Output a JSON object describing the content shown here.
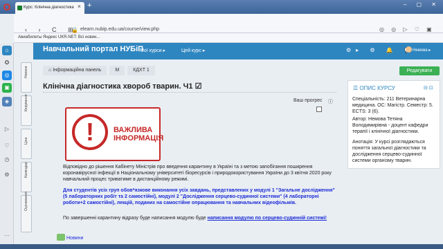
{
  "browser": {
    "tab_title": "Курс: Клінічна діагностика",
    "close": "×",
    "new_tab": "+",
    "window_controls": "– ▢ ✕",
    "nav": "‹ › C ⊞",
    "url": "elearn.nubip.edu.ua/course/view.php",
    "right_icons": "◎ ◎ ▷ ♡ ▣ ⤓",
    "bookmarks": "Авиабилеты  Яндекс  UKR.NET: Всі новин..."
  },
  "sidebar_icons": [
    "⌂",
    "✪",
    "◎",
    "▣",
    "◈",
    "▷",
    "♡",
    "◷",
    "⚙",
    "···"
  ],
  "vertical_tabs": [
    "Новини",
    "Керування",
    "Ціна",
    "Календар",
    "Оцінювання"
  ],
  "navbar": {
    "brand": "Навчальний портал НУБіП",
    "my_courses": "Мої курси ▸",
    "this_course": "Цей курс ▸",
    "icons": "⚙▸ ⚙ 🔔 💬",
    "user": "Немова ▸"
  },
  "breadcrumb": [
    "Інформаційна панель",
    "М",
    "КДХТ 1"
  ],
  "edit_button": "Редагувати",
  "course_title": "Клінічна діагностика хвороб тварин. Ч1 ☑",
  "progress_label": "Ваш прогрес",
  "warning": {
    "line1": "ВАЖЛИВА",
    "line2": "ІНФОРМАЦІЯ",
    "icon": "!"
  },
  "p1": "Відповідно до рішення Кабінету Міністрів про введення карантину в Україні та з метою запобігання поширення коронавірусної інфекції в Національному університеті біоресурсів і природокористування України до 3 квітня 2020 року навчальний процес триватиме в дистанційному режимі.",
  "p2": "Для студентів усіх груп обов*язкове виконання усіх завдань, представлених у модулі 1 \"Загальне дослідження\" (5 лабораторних робіт та 2 самостійні), модулі 2 \"Дослідження серцево-судинної системи\" (4 лабораторні роботи+2 самостійні), лекцій, поданих на самостійне опрацювання та навчальних відеофільмів.",
  "p3_text": "По завершенні карантину відразу буде написання модулю буде ",
  "p3_link": "написання модулю по серцево-судинній системі!",
  "news": "Новини",
  "block": {
    "header": "ОПИС КУРСУ",
    "controls": "⊟ ⊡",
    "b1": "Спеціальність: 211 Ветеринарна медицина. ОС: Магістр. Семестр: 5. ECTS: 3 (6).",
    "b2": "Автор: Немова Тетяна Володимирівна - доцент кафедри терапії і клінічної діагностики.",
    "b3": "Анотація: У курсі розглядаються поняття загальної діагностики та дослідження серцево-судинної системи організму тварин."
  }
}
